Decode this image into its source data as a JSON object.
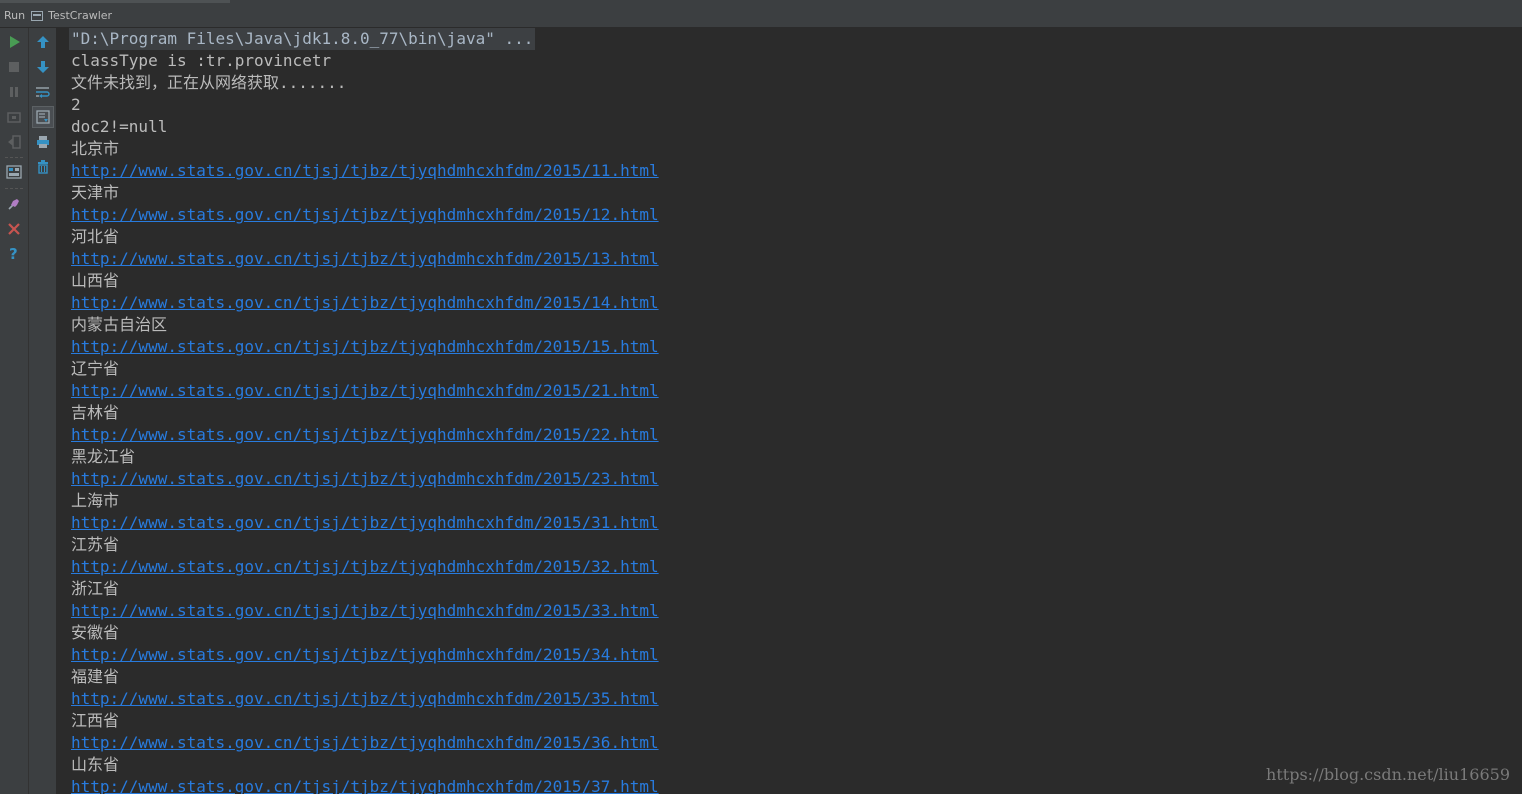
{
  "run_panel": {
    "label": "Run",
    "config_name": "TestCrawler"
  },
  "toolbar": {
    "left_icons": [
      "rerun-icon",
      "stop-icon",
      "pause-icon",
      "dump-threads-icon",
      "exit-icon",
      "layout-icon",
      "pin-icon",
      "close-icon",
      "help-icon"
    ],
    "right_icons": [
      "up-arrow-icon",
      "down-arrow-icon",
      "soft-wrap-icon",
      "scroll-to-end-icon",
      "print-icon",
      "clear-icon"
    ]
  },
  "console": {
    "lines": [
      {
        "type": "cmd",
        "text": "\"D:\\Program Files\\Java\\jdk1.8.0_77\\bin\\java\" ..."
      },
      {
        "type": "text",
        "text": "classType is :tr.provincetr"
      },
      {
        "type": "text",
        "text": "文件未找到，正在从网络获取......."
      },
      {
        "type": "text",
        "text": "2"
      },
      {
        "type": "text",
        "text": "doc2!=null"
      },
      {
        "type": "text",
        "text": "北京市"
      },
      {
        "type": "link",
        "text": "http://www.stats.gov.cn/tjsj/tjbz/tjyqhdmhcxhfdm/2015/11.html"
      },
      {
        "type": "text",
        "text": "天津市"
      },
      {
        "type": "link",
        "text": "http://www.stats.gov.cn/tjsj/tjbz/tjyqhdmhcxhfdm/2015/12.html"
      },
      {
        "type": "text",
        "text": "河北省"
      },
      {
        "type": "link",
        "text": "http://www.stats.gov.cn/tjsj/tjbz/tjyqhdmhcxhfdm/2015/13.html"
      },
      {
        "type": "text",
        "text": "山西省"
      },
      {
        "type": "link",
        "text": "http://www.stats.gov.cn/tjsj/tjbz/tjyqhdmhcxhfdm/2015/14.html"
      },
      {
        "type": "text",
        "text": "内蒙古自治区"
      },
      {
        "type": "link",
        "text": "http://www.stats.gov.cn/tjsj/tjbz/tjyqhdmhcxhfdm/2015/15.html"
      },
      {
        "type": "text",
        "text": "辽宁省"
      },
      {
        "type": "link",
        "text": "http://www.stats.gov.cn/tjsj/tjbz/tjyqhdmhcxhfdm/2015/21.html"
      },
      {
        "type": "text",
        "text": "吉林省"
      },
      {
        "type": "link",
        "text": "http://www.stats.gov.cn/tjsj/tjbz/tjyqhdmhcxhfdm/2015/22.html"
      },
      {
        "type": "text",
        "text": "黑龙江省"
      },
      {
        "type": "link",
        "text": "http://www.stats.gov.cn/tjsj/tjbz/tjyqhdmhcxhfdm/2015/23.html"
      },
      {
        "type": "text",
        "text": "上海市"
      },
      {
        "type": "link",
        "text": "http://www.stats.gov.cn/tjsj/tjbz/tjyqhdmhcxhfdm/2015/31.html"
      },
      {
        "type": "text",
        "text": "江苏省"
      },
      {
        "type": "link",
        "text": "http://www.stats.gov.cn/tjsj/tjbz/tjyqhdmhcxhfdm/2015/32.html"
      },
      {
        "type": "text",
        "text": "浙江省"
      },
      {
        "type": "link",
        "text": "http://www.stats.gov.cn/tjsj/tjbz/tjyqhdmhcxhfdm/2015/33.html"
      },
      {
        "type": "text",
        "text": "安徽省"
      },
      {
        "type": "link",
        "text": "http://www.stats.gov.cn/tjsj/tjbz/tjyqhdmhcxhfdm/2015/34.html"
      },
      {
        "type": "text",
        "text": "福建省"
      },
      {
        "type": "link",
        "text": "http://www.stats.gov.cn/tjsj/tjbz/tjyqhdmhcxhfdm/2015/35.html"
      },
      {
        "type": "text",
        "text": "江西省"
      },
      {
        "type": "link",
        "text": "http://www.stats.gov.cn/tjsj/tjbz/tjyqhdmhcxhfdm/2015/36.html"
      },
      {
        "type": "text",
        "text": "山东省"
      },
      {
        "type": "link",
        "text": "http://www.stats.gov.cn/tjsj/tjbz/tjyqhdmhcxhfdm/2015/37.html"
      }
    ]
  },
  "watermark": "https://blog.csdn.net/liu16659",
  "colors": {
    "background": "#2b2b2b",
    "panel": "#3c3f41",
    "text": "#bbbbbb",
    "link": "#287bde",
    "run_green": "#499c54",
    "close_red": "#c75450",
    "help_blue": "#3592c4"
  }
}
